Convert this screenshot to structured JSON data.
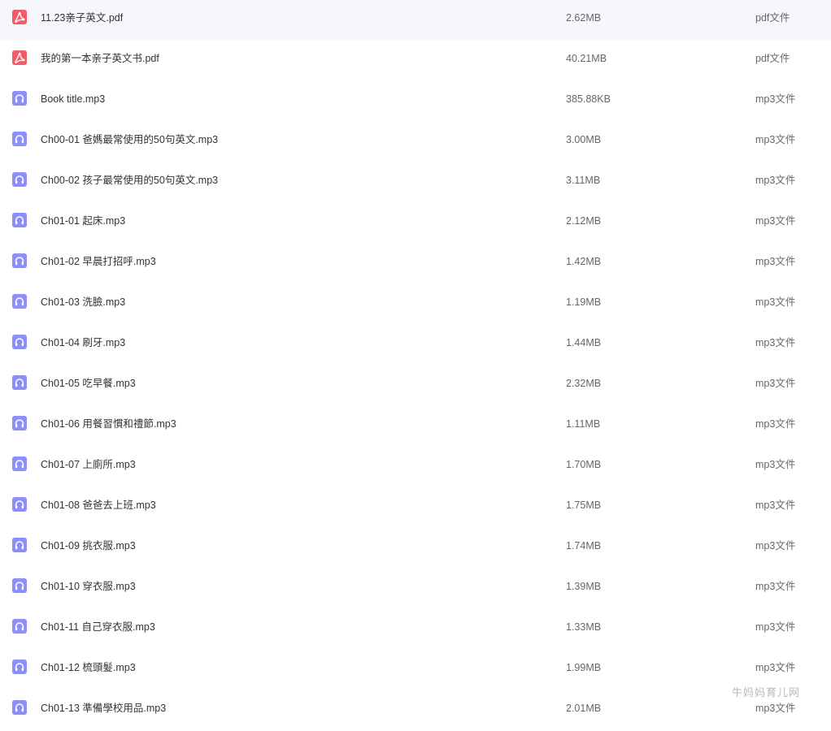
{
  "colors": {
    "pdf_icon": "#f25b6a",
    "mp3_icon": "#8b8ff7",
    "name_text": "#333333",
    "meta_text": "#666666",
    "watermark_text": "#b8b8b8"
  },
  "files": [
    {
      "icon": "pdf-icon",
      "name": "11.23亲子英文.pdf",
      "size": "2.62MB",
      "type": "pdf文件"
    },
    {
      "icon": "pdf-icon",
      "name": "我的第一本亲子英文书.pdf",
      "size": "40.21MB",
      "type": "pdf文件"
    },
    {
      "icon": "headphones-icon",
      "name": "Book title.mp3",
      "size": "385.88KB",
      "type": "mp3文件"
    },
    {
      "icon": "headphones-icon",
      "name": "Ch00-01 爸媽最常使用的50句英文.mp3",
      "size": "3.00MB",
      "type": "mp3文件"
    },
    {
      "icon": "headphones-icon",
      "name": "Ch00-02 孩子最常使用的50句英文.mp3",
      "size": "3.11MB",
      "type": "mp3文件"
    },
    {
      "icon": "headphones-icon",
      "name": "Ch01-01 起床.mp3",
      "size": "2.12MB",
      "type": "mp3文件"
    },
    {
      "icon": "headphones-icon",
      "name": "Ch01-02 早晨打招呼.mp3",
      "size": "1.42MB",
      "type": "mp3文件"
    },
    {
      "icon": "headphones-icon",
      "name": "Ch01-03 洗臉.mp3",
      "size": "1.19MB",
      "type": "mp3文件"
    },
    {
      "icon": "headphones-icon",
      "name": "Ch01-04 刷牙.mp3",
      "size": "1.44MB",
      "type": "mp3文件"
    },
    {
      "icon": "headphones-icon",
      "name": "Ch01-05 吃早餐.mp3",
      "size": "2.32MB",
      "type": "mp3文件"
    },
    {
      "icon": "headphones-icon",
      "name": "Ch01-06 用餐習慣和禮節.mp3",
      "size": "1.11MB",
      "type": "mp3文件"
    },
    {
      "icon": "headphones-icon",
      "name": "Ch01-07 上廁所.mp3",
      "size": "1.70MB",
      "type": "mp3文件"
    },
    {
      "icon": "headphones-icon",
      "name": "Ch01-08 爸爸去上班.mp3",
      "size": "1.75MB",
      "type": "mp3文件"
    },
    {
      "icon": "headphones-icon",
      "name": "Ch01-09 挑衣服.mp3",
      "size": "1.74MB",
      "type": "mp3文件"
    },
    {
      "icon": "headphones-icon",
      "name": "Ch01-10 穿衣服.mp3",
      "size": "1.39MB",
      "type": "mp3文件"
    },
    {
      "icon": "headphones-icon",
      "name": "Ch01-11 自己穿衣服.mp3",
      "size": "1.33MB",
      "type": "mp3文件"
    },
    {
      "icon": "headphones-icon",
      "name": "Ch01-12 梳頭髮.mp3",
      "size": "1.99MB",
      "type": "mp3文件"
    },
    {
      "icon": "headphones-icon",
      "name": "Ch01-13 準備學校用品.mp3",
      "size": "2.01MB",
      "type": "mp3文件"
    }
  ],
  "watermark": "牛妈妈育儿网"
}
